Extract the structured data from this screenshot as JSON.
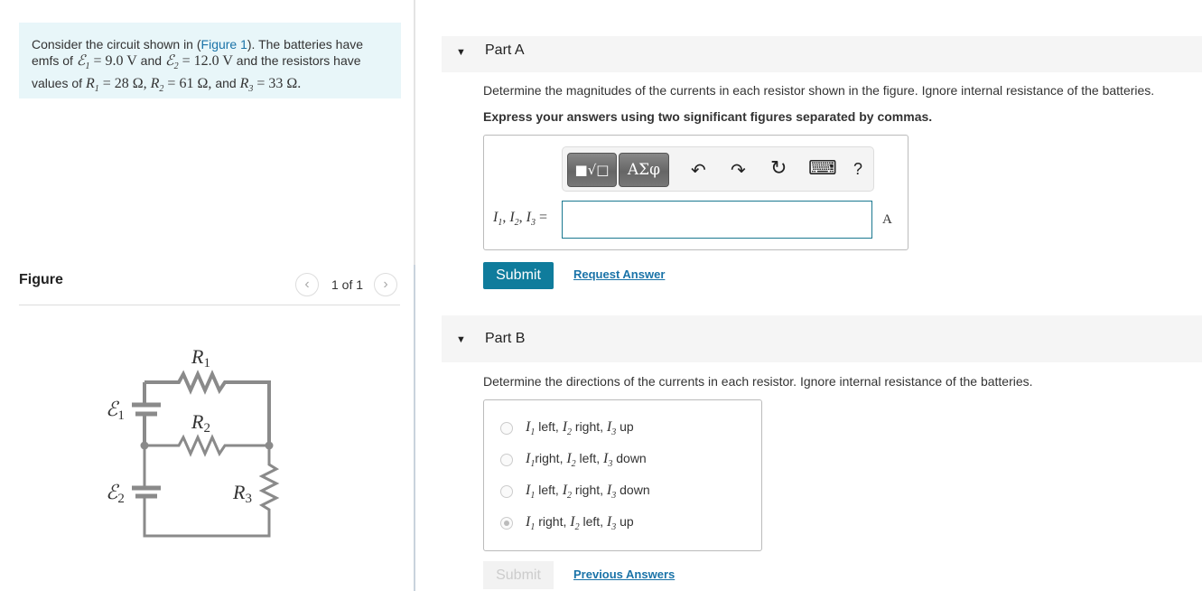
{
  "problem": [
    {
      "t": "Consider the circuit shown in ("
    },
    {
      "link": "Figure 1"
    },
    {
      "t": "). The batteries have emfs of "
    },
    {
      "m": "ℰ",
      "sub": "1"
    },
    {
      "r": " = 9.0 V"
    },
    {
      "t": " and "
    },
    {
      "m": "ℰ",
      "sub": "2"
    },
    {
      "r": " = 12.0 V"
    },
    {
      "t": " and the resistors have values of "
    },
    {
      "m": "R",
      "sub": "1"
    },
    {
      "r": " = 28 Ω, "
    },
    {
      "m": "R",
      "sub": "2"
    },
    {
      "r": " = 61 Ω, "
    },
    {
      "t": "and "
    },
    {
      "m": "R",
      "sub": "3"
    },
    {
      "r": " = 33 Ω."
    }
  ],
  "figure": {
    "title": "Figure",
    "pager": "1 of 1",
    "prev_icon": "chevron-left",
    "next_icon": "chevron-right",
    "labels": {
      "r1": "R",
      "r1s": "1",
      "r2": "R",
      "r2s": "2",
      "r3": "R",
      "r3s": "3",
      "e1": "ℰ",
      "e1s": "1",
      "e2": "ℰ",
      "e2s": "2"
    }
  },
  "partA": {
    "label": "Part A",
    "question": "Determine the magnitudes of the currents in each resistor shown in the figure. Ignore internal resistance of the batteries.",
    "instruction": "Express your answers using two significant figures separated by commas.",
    "toolbar": {
      "template": "■√□",
      "greek": "ΑΣφ",
      "undo": "↶",
      "redo": "↷",
      "reset": "↻",
      "keyboard": "⌨",
      "help": "?"
    },
    "answer_label": [
      {
        "m": "I",
        "sub": "1"
      },
      {
        "r": ", "
      },
      {
        "m": "I",
        "sub": "2"
      },
      {
        "r": ", "
      },
      {
        "m": "I",
        "sub": "3"
      },
      {
        "r": " ="
      }
    ],
    "answer_value": "",
    "unit": "A",
    "submit": "Submit",
    "request": "Request Answer"
  },
  "partB": {
    "label": "Part B",
    "question": "Determine the directions of the currents in each resistor. Ignore internal resistance of the batteries.",
    "options": [
      {
        "selected": false,
        "seg": [
          {
            "m": "I",
            "sub": "1"
          },
          {
            "t": " left, "
          },
          {
            "m": "I",
            "sub": "2"
          },
          {
            "t": " right, "
          },
          {
            "m": "I",
            "sub": "3"
          },
          {
            "t": " up"
          }
        ]
      },
      {
        "selected": false,
        "seg": [
          {
            "m": "I",
            "sub": "1"
          },
          {
            "t": "right, "
          },
          {
            "m": "I",
            "sub": "2"
          },
          {
            "t": " left, "
          },
          {
            "m": "I",
            "sub": "3"
          },
          {
            "t": " down"
          }
        ]
      },
      {
        "selected": false,
        "seg": [
          {
            "m": "I",
            "sub": "1"
          },
          {
            "t": " left, "
          },
          {
            "m": "I",
            "sub": "2"
          },
          {
            "t": " right, "
          },
          {
            "m": "I",
            "sub": "3"
          },
          {
            "t": " down"
          }
        ]
      },
      {
        "selected": true,
        "seg": [
          {
            "m": "I",
            "sub": "1"
          },
          {
            "t": " right, "
          },
          {
            "m": "I",
            "sub": "2"
          },
          {
            "t": " left, "
          },
          {
            "m": "I",
            "sub": "3"
          },
          {
            "t": " up"
          }
        ]
      }
    ],
    "submit": "Submit",
    "previous": "Previous Answers"
  },
  "colors": {
    "accent": "#0f7c9c",
    "link": "#1a73a8",
    "problem_bg": "#e8f6f9",
    "wire": "#8a8a8a"
  }
}
